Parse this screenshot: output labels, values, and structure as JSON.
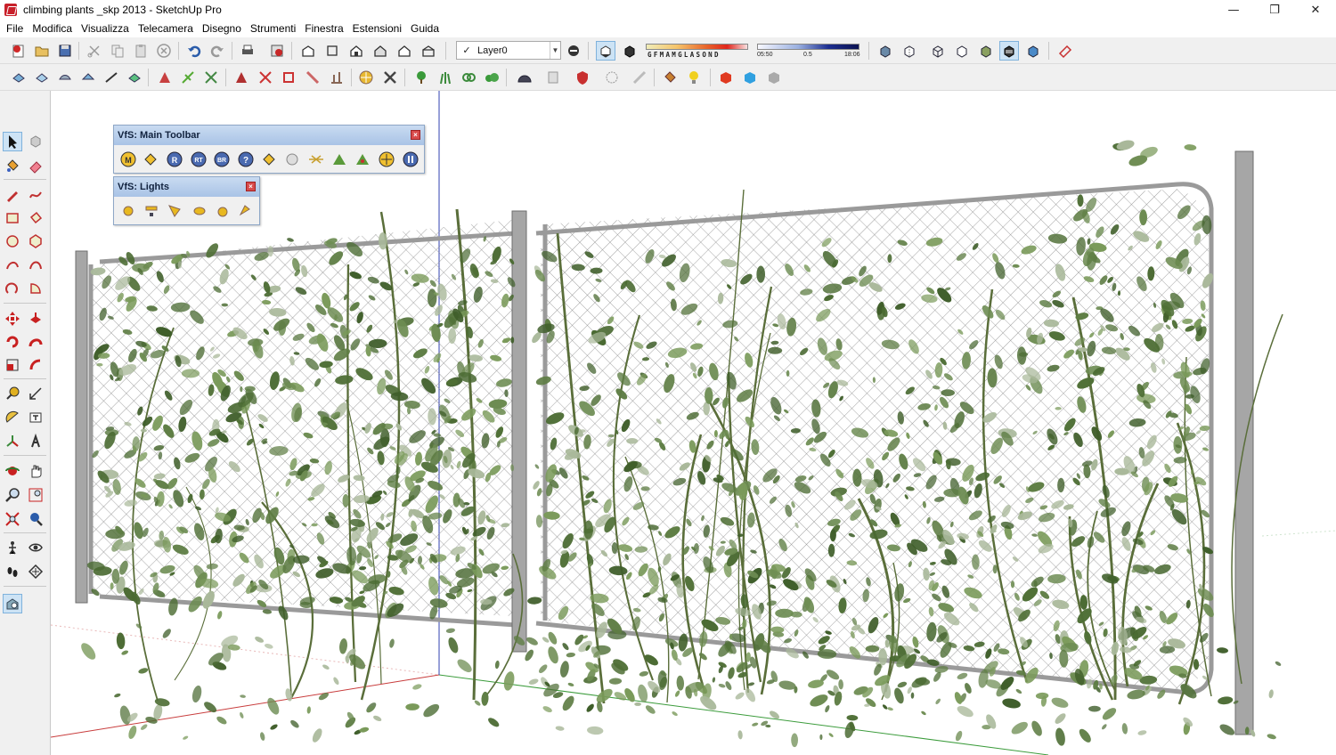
{
  "window": {
    "title": "climbing plants _skp 2013 - SketchUp Pro",
    "minimize_glyph": "—",
    "restore_glyph": "❐",
    "close_glyph": "✕"
  },
  "menu": [
    "File",
    "Modifica",
    "Visualizza",
    "Telecamera",
    "Disegno",
    "Strumenti",
    "Finestra",
    "Estensioni",
    "Guida"
  ],
  "layer": {
    "check": "✓",
    "name": "Layer0"
  },
  "shadow": {
    "months": "GFMAMGLASOND",
    "time_start": "05:50",
    "time_mid": "0.5",
    "time_end": "18:06"
  },
  "panels": {
    "main_toolbar": {
      "title": "VfS: Main Toolbar",
      "close": "×",
      "buttons": [
        "M",
        "",
        "R",
        "RT",
        "BR",
        "?",
        "",
        "",
        "",
        "",
        "",
        "",
        ""
      ]
    },
    "lights": {
      "title": "VfS: Lights",
      "close": "×"
    }
  },
  "colors": {
    "viewport_bg": "#ffffff",
    "toolbar_bg": "#f0f0f0",
    "panel_header": "#a9c3e6",
    "foliage_dark": "#3f5e2a",
    "foliage_light": "#7a9a5a",
    "fence_metal": "#9a9a9a",
    "axis_red": "#c83c3c",
    "axis_green": "#3c9c3c",
    "axis_blue": "#3040b0"
  }
}
